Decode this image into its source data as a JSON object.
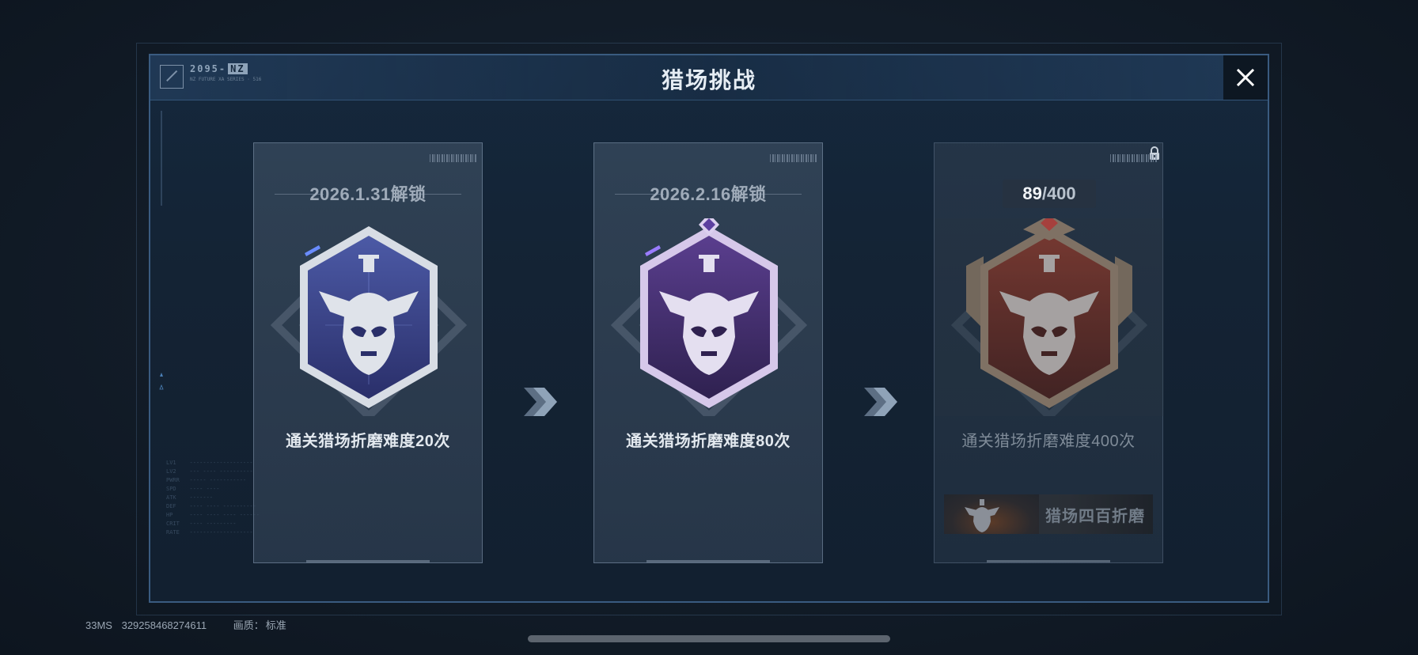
{
  "header": {
    "logo_text": "2095-",
    "logo_tag": "NZ",
    "logo_sub": "NZ FUTURE XA SERIES · 516",
    "title": "猎场挑战",
    "close_icon": "close-icon"
  },
  "cards": [
    {
      "unlock_text": "2026.1.31解锁",
      "requirement": "通关猎场折磨难度20次",
      "badge_tier": "blue",
      "badge_color": "#3e4a8c"
    },
    {
      "unlock_text": "2026.2.16解锁",
      "requirement": "通关猎场折磨难度80次",
      "badge_tier": "purple",
      "badge_color": "#4a3478"
    },
    {
      "progress_current": "89",
      "progress_total": "/400",
      "requirement": "通关猎场折磨难度400次",
      "reward_label": "猎场四百折磨",
      "badge_tier": "red",
      "badge_color": "#7a3026",
      "locked": true
    }
  ],
  "status_bar": {
    "ping": "33MS",
    "uid": "329258468274611",
    "quality_label": "画质：",
    "quality_value": "标准"
  },
  "colors": {
    "panel_border": "#3a5b80",
    "title": "#e6edf4"
  }
}
